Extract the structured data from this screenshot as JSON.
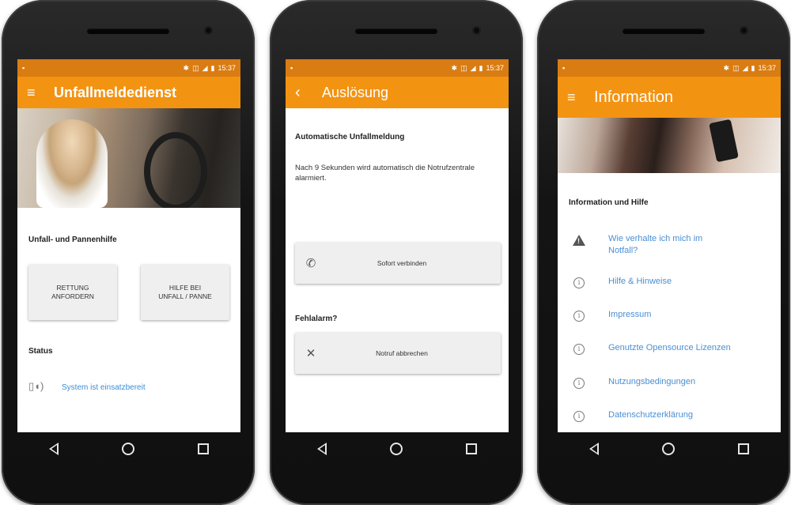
{
  "colors": {
    "appbar": "#f39312",
    "statusbar": "#d97c12",
    "link": "#3b8ed6",
    "phone_body": "#141414"
  },
  "status_bar": {
    "left_icon": "notification-icon",
    "right_icons": [
      "bluetooth-icon",
      "vibrate-icon",
      "signal-icon",
      "battery-icon"
    ],
    "time": "15:37"
  },
  "screen1": {
    "title": "Unfallmeldedienst",
    "section_help": "Unfall- und Pannenhilfe",
    "btn_rescue": "RETTUNG\nANFORDERN",
    "btn_help": "HILFE BEI\nUNFALL / PANNE",
    "section_status": "Status",
    "status_text": "System ist einsatzbereit"
  },
  "screen2": {
    "title": "Auslösung",
    "heading": "Automatische Unfallmeldung",
    "description": "Nach 9 Sekunden wird automatisch die Notrufzentrale alarmiert.",
    "btn_connect": "Sofort verbinden",
    "false_alarm": "Fehlalarm?",
    "btn_cancel": "Notruf abbrechen"
  },
  "screen3": {
    "title": "Information",
    "section": "Information und Hilfe",
    "items": [
      {
        "label": "Wie verhalte ich mich im\nNotfall?",
        "icon": "warning-icon"
      },
      {
        "label": "Hilfe & Hinweise",
        "icon": "info-icon"
      },
      {
        "label": "Impressum",
        "icon": "info-icon"
      },
      {
        "label": "Genutzte Opensource Lizenzen",
        "icon": "info-icon"
      },
      {
        "label": "Nutzungsbedingungen",
        "icon": "info-icon"
      },
      {
        "label": "Datenschutzerklärung",
        "icon": "info-icon"
      }
    ]
  }
}
